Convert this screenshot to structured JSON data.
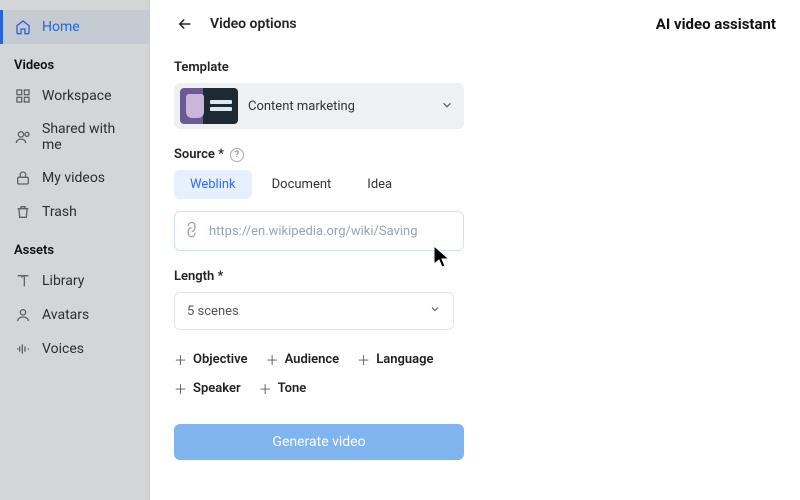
{
  "sidebar": {
    "home": "Home",
    "sections": {
      "videos": "Videos",
      "assets": "Assets"
    },
    "items": {
      "workspace": "Workspace",
      "shared": "Shared with me",
      "myvideos": "My videos",
      "trash": "Trash",
      "library": "Library",
      "avatars": "Avatars",
      "voices": "Voices"
    }
  },
  "header": {
    "title": "Video options",
    "assistant": "AI video assistant"
  },
  "template": {
    "label": "Template",
    "selected": "Content marketing"
  },
  "source": {
    "label": "Source *",
    "tabs": {
      "weblink": "Weblink",
      "document": "Document",
      "idea": "Idea"
    },
    "placeholder": "https://en.wikipedia.org/wiki/Saving",
    "value": ""
  },
  "length": {
    "label": "Length *",
    "selected": "5 scenes"
  },
  "chips": {
    "objective": "Objective",
    "audience": "Audience",
    "language": "Language",
    "speaker": "Speaker",
    "tone": "Tone"
  },
  "actions": {
    "generate": "Generate video"
  }
}
